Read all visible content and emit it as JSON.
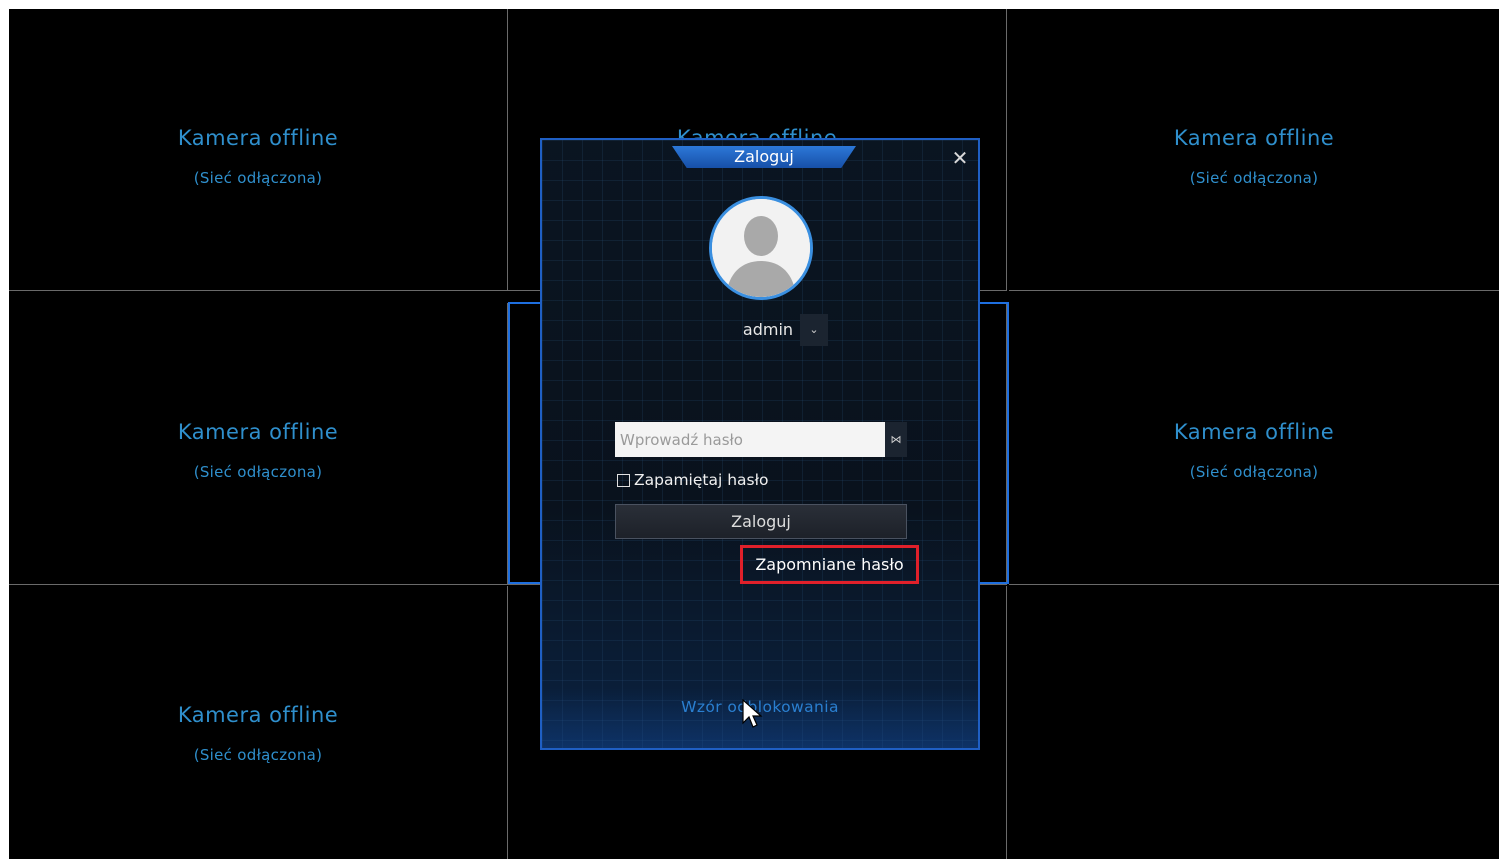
{
  "cells": [
    {
      "title": "Kamera offline",
      "subtitle": "(Sieć odłączona)"
    },
    {
      "title": "Kamera offline",
      "subtitle": ""
    },
    {
      "title": "Kamera offline",
      "subtitle": "(Sieć odłączona)"
    },
    {
      "title": "Kamera offline",
      "subtitle": "(Sieć odłączona)"
    },
    {
      "title": "",
      "subtitle": ""
    },
    {
      "title": "Kamera offline",
      "subtitle": "(Sieć odłączona)"
    },
    {
      "title": "Kamera offline",
      "subtitle": "(Sieć odłączona)"
    },
    {
      "title": "",
      "subtitle": ""
    },
    {
      "title": "",
      "subtitle": ""
    }
  ],
  "dialog": {
    "title": "Zaloguj",
    "close_glyph": "✕",
    "username": "admin",
    "user_dropdown_glyph": "⌄",
    "password_placeholder": "Wprowadź hasło",
    "password_value": "",
    "eye_glyph": "⋈",
    "remember_label": "Zapamiętaj hasło",
    "remember_checked": false,
    "login_button": "Zaloguj",
    "forgot_link": "Zapomniane hasło",
    "pattern_link": "Wzór odblokowania"
  },
  "colors": {
    "accent_blue": "#1e6fe0",
    "highlight_red": "#e0202a",
    "offline_text": "#2f8fcc"
  }
}
